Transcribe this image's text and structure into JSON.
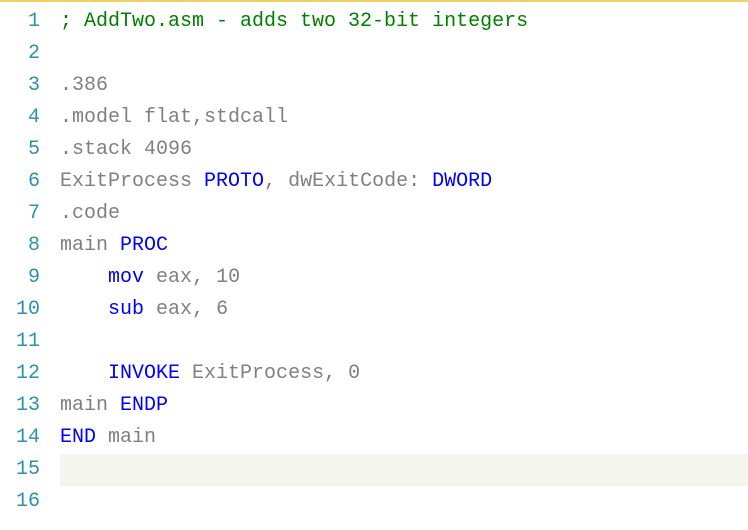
{
  "lines": [
    {
      "num": "1",
      "segments": [
        {
          "cls": "comment",
          "text": "; AddTwo.asm - adds two 32-bit integers"
        }
      ]
    },
    {
      "num": "2",
      "segments": []
    },
    {
      "num": "3",
      "segments": [
        {
          "cls": "directive",
          "text": ".386"
        }
      ]
    },
    {
      "num": "4",
      "segments": [
        {
          "cls": "directive",
          "text": ".model"
        },
        {
          "cls": "",
          "text": " "
        },
        {
          "cls": "identifier",
          "text": "flat,stdcall"
        }
      ]
    },
    {
      "num": "5",
      "segments": [
        {
          "cls": "directive",
          "text": ".stack"
        },
        {
          "cls": "",
          "text": " "
        },
        {
          "cls": "number",
          "text": "4096"
        }
      ]
    },
    {
      "num": "6",
      "segments": [
        {
          "cls": "identifier",
          "text": "ExitProcess"
        },
        {
          "cls": "",
          "text": " "
        },
        {
          "cls": "keyword",
          "text": "PROTO"
        },
        {
          "cls": "identifier",
          "text": ", dwExitCode: "
        },
        {
          "cls": "keyword",
          "text": "DWORD"
        }
      ]
    },
    {
      "num": "7",
      "segments": [
        {
          "cls": "directive",
          "text": ".code"
        }
      ]
    },
    {
      "num": "8",
      "segments": [
        {
          "cls": "identifier",
          "text": "main"
        },
        {
          "cls": "",
          "text": " "
        },
        {
          "cls": "keyword",
          "text": "PROC"
        }
      ]
    },
    {
      "num": "9",
      "segments": [
        {
          "cls": "",
          "text": "    "
        },
        {
          "cls": "inst",
          "text": "mov"
        },
        {
          "cls": "",
          "text": " "
        },
        {
          "cls": "register",
          "text": "eax"
        },
        {
          "cls": "identifier",
          "text": ", "
        },
        {
          "cls": "number",
          "text": "10"
        }
      ]
    },
    {
      "num": "10",
      "segments": [
        {
          "cls": "",
          "text": "    "
        },
        {
          "cls": "inst",
          "text": "sub"
        },
        {
          "cls": "",
          "text": " "
        },
        {
          "cls": "register",
          "text": "eax"
        },
        {
          "cls": "identifier",
          "text": ", "
        },
        {
          "cls": "number",
          "text": "6"
        }
      ]
    },
    {
      "num": "11",
      "segments": []
    },
    {
      "num": "12",
      "segments": [
        {
          "cls": "",
          "text": "    "
        },
        {
          "cls": "keyword",
          "text": "INVOKE"
        },
        {
          "cls": "",
          "text": " "
        },
        {
          "cls": "identifier",
          "text": "ExitProcess, "
        },
        {
          "cls": "number",
          "text": "0"
        }
      ]
    },
    {
      "num": "13",
      "segments": [
        {
          "cls": "identifier",
          "text": "main"
        },
        {
          "cls": "",
          "text": " "
        },
        {
          "cls": "keyword",
          "text": "ENDP"
        }
      ]
    },
    {
      "num": "14",
      "segments": [
        {
          "cls": "keyword",
          "text": "END"
        },
        {
          "cls": "",
          "text": " "
        },
        {
          "cls": "identifier",
          "text": "main"
        }
      ]
    },
    {
      "num": "15",
      "segments": [],
      "highlighted": true
    },
    {
      "num": "16",
      "segments": []
    }
  ]
}
